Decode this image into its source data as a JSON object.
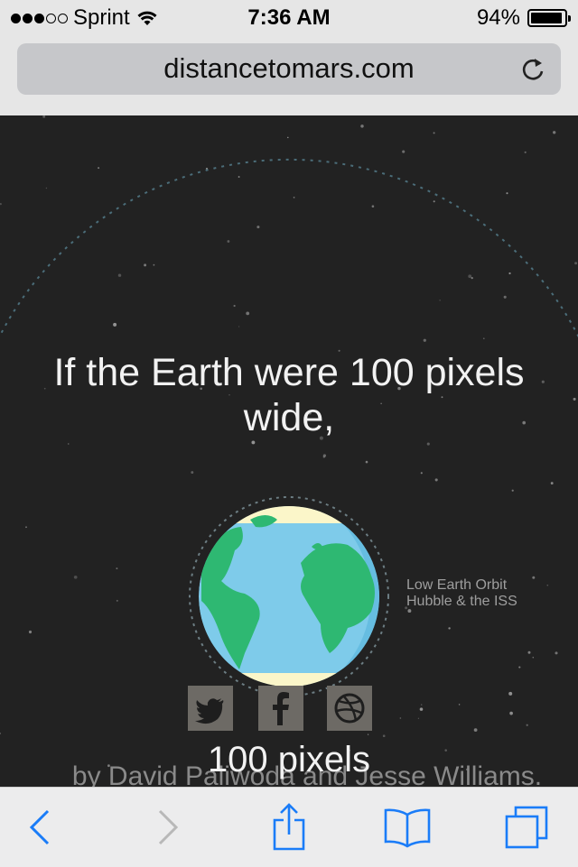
{
  "status_bar": {
    "signal_dots_filled": 3,
    "signal_dots_total": 5,
    "carrier": "Sprint",
    "time": "7:36 AM",
    "battery_text": "94%",
    "battery_level": 0.94
  },
  "browser": {
    "url": "distancetomars.com"
  },
  "page": {
    "headline": "If the Earth were 100 pixels wide,",
    "orbit_label_line1": "Low Earth Orbit",
    "orbit_label_line2": "Hubble & the ISS",
    "size_label": "100 pixels",
    "byline": "by David Paliwoda and Jesse Williams."
  },
  "social": {
    "twitter_icon": "twitter-icon",
    "facebook_icon": "facebook-icon",
    "dribbble_icon": "dribbble-icon"
  },
  "toolbar": {
    "back_icon": "back-arrow-icon",
    "forward_icon": "forward-arrow-icon",
    "share_icon": "share-icon",
    "bookmarks_icon": "bookmarks-icon",
    "tabs_icon": "tabs-icon"
  },
  "colors": {
    "space_bg": "#222222",
    "ocean": "#7ecbea",
    "land": "#2eb872",
    "ice": "#fbf6c9",
    "ios_blue": "#1a7cf8",
    "social_bg": "#6d6a65"
  }
}
